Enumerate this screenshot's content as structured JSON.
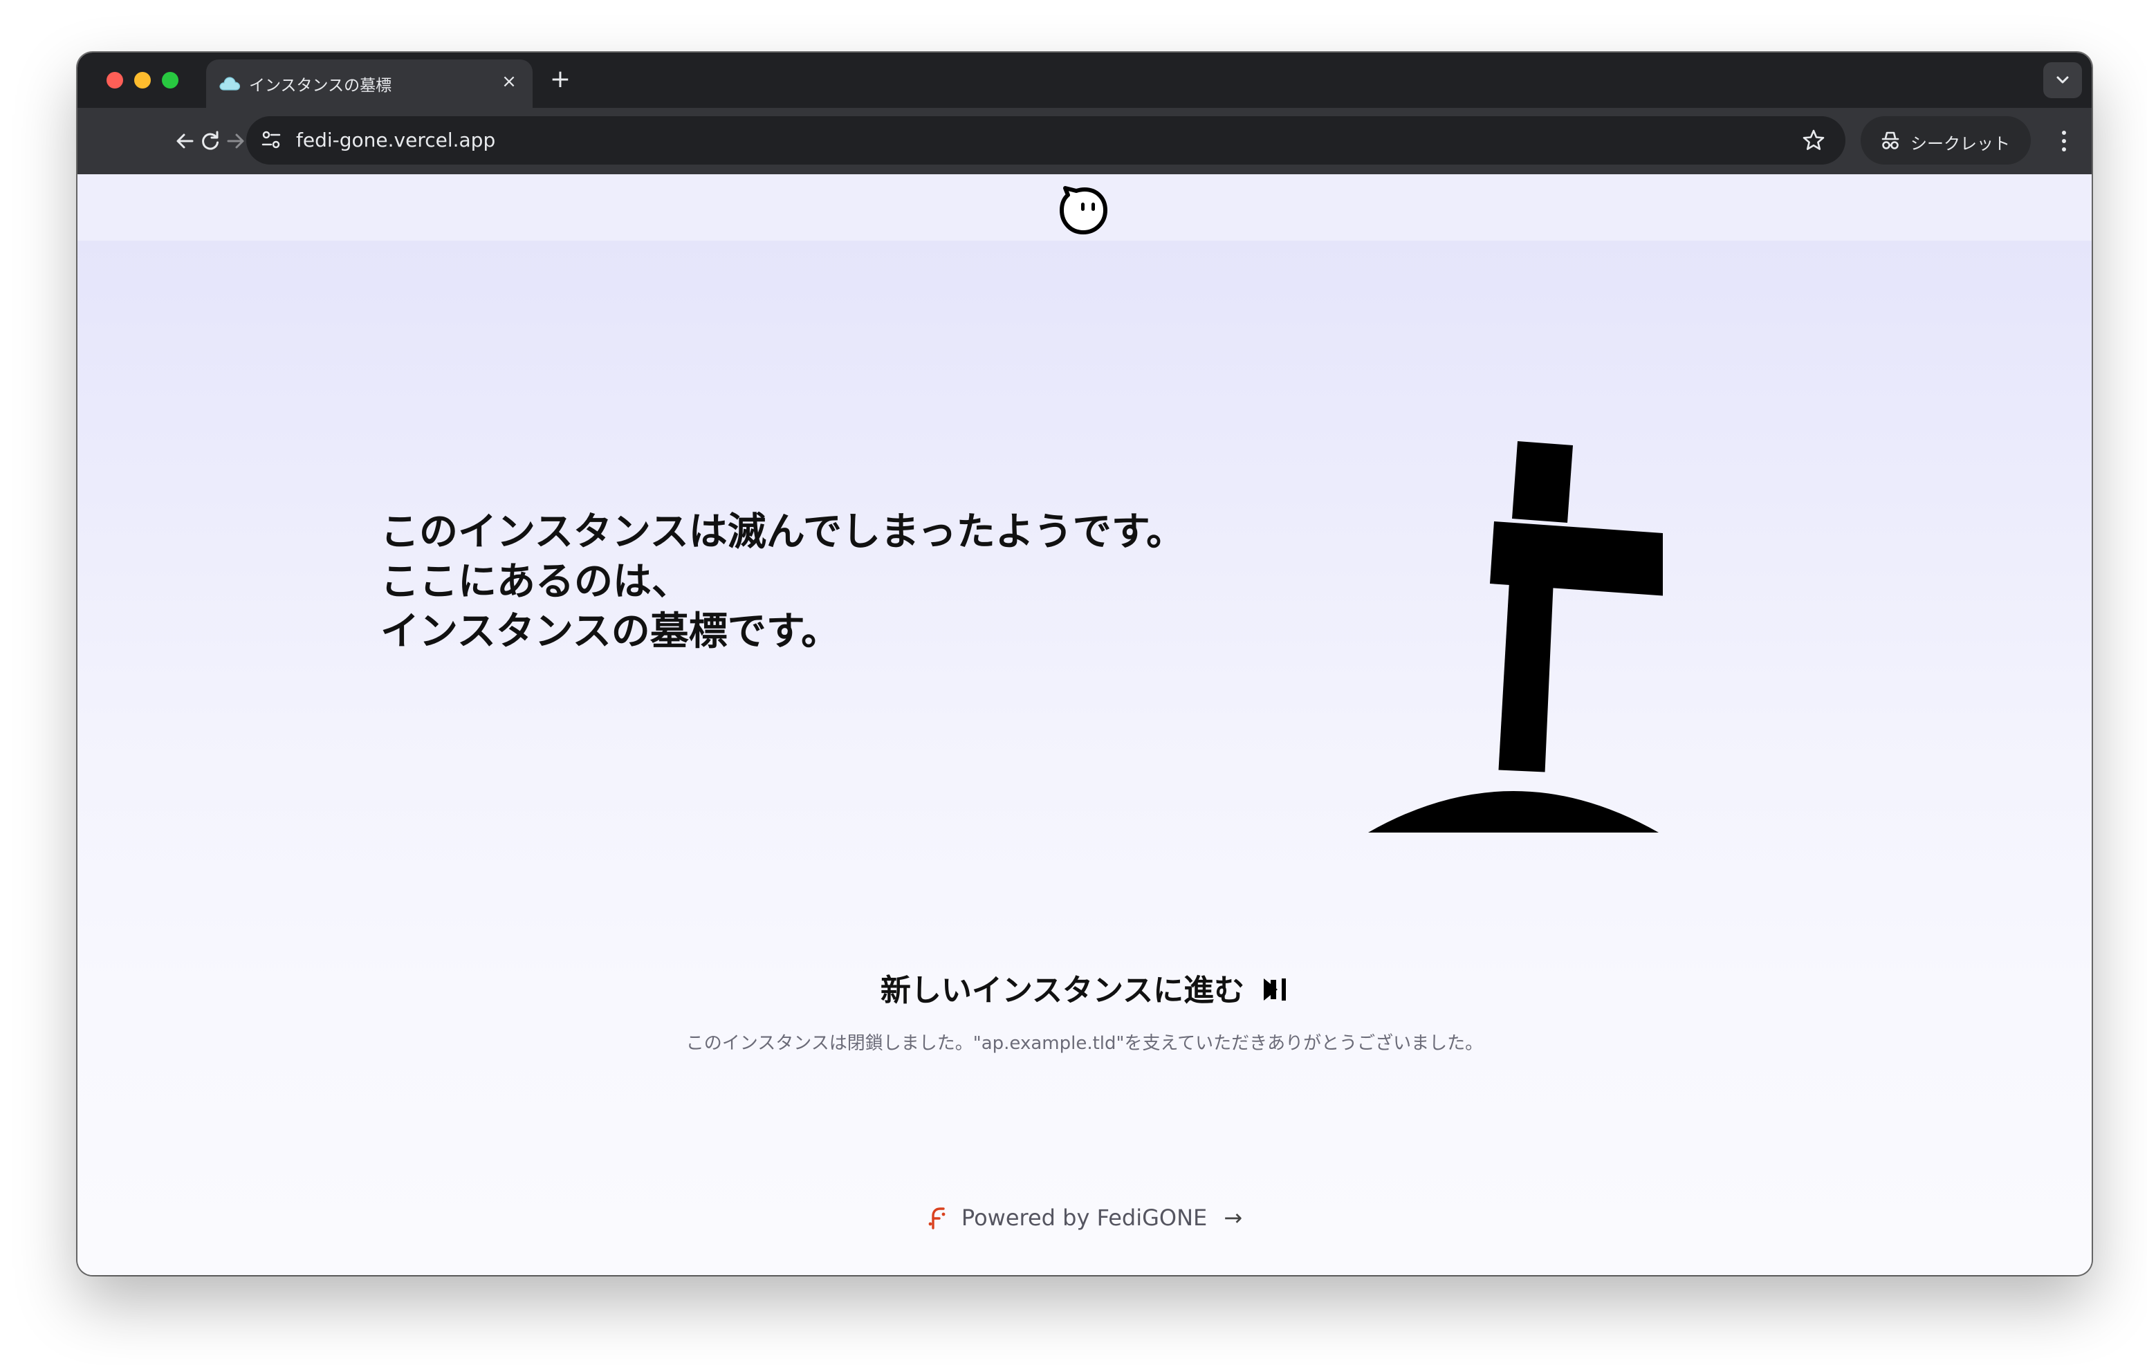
{
  "browser": {
    "tab": {
      "title": "インスタンスの墓標",
      "close_glyph": "×"
    },
    "new_tab_glyph": "+",
    "url": "fedi-gone.vercel.app",
    "incognito_label": "シークレット"
  },
  "page": {
    "headline": [
      "このインスタンスは滅んでしまったようです。",
      "ここにあるのは、",
      "インスタンスの墓標です。"
    ],
    "cta_label": "新しいインスタンスに進む",
    "farewell": "このインスタンスは閉鎖しました。\"ap.example.tld\"を支えていただきありがとうございました。",
    "powered_by": "Powered by FediGONE",
    "powered_arrow": "→"
  },
  "colors": {
    "tabstrip": "#202124",
    "toolbar": "#35363a",
    "page_gradient_top": "#e3e3fa",
    "page_gradient_bottom": "#fafafe",
    "fedigone_logo": "#d9411e"
  },
  "icons": {
    "favicon": "cloud-icon",
    "back": "arrow-left-icon",
    "forward": "arrow-right-icon",
    "reload": "reload-icon",
    "site_info": "tune-icon",
    "bookmark": "star-icon",
    "incognito": "incognito-icon",
    "menu": "kebab-menu-icon",
    "logo": "ghost-face-icon",
    "tombstone": "grave-cross-icon",
    "cta": "skip-forward-icon",
    "powered": "fedigone-logo-icon"
  }
}
